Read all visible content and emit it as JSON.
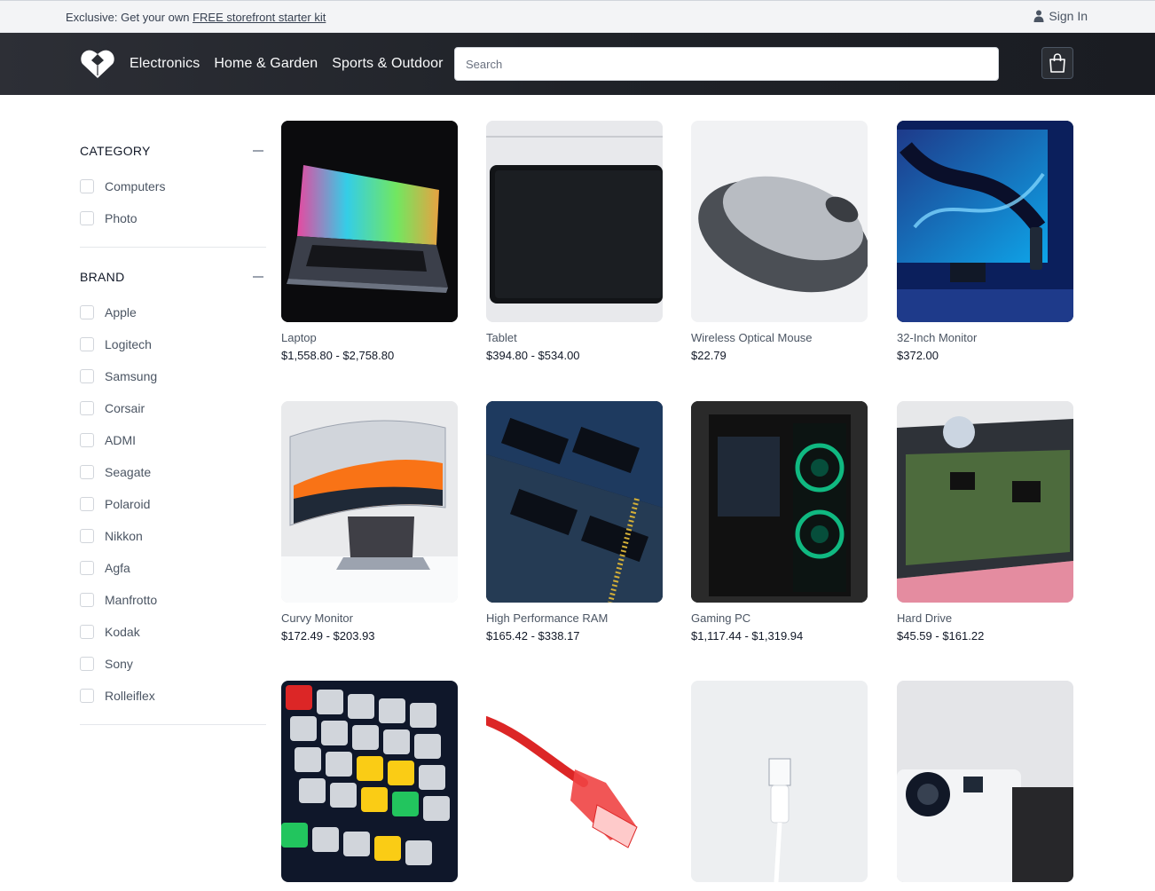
{
  "promo": {
    "prefix": "Exclusive: Get your own ",
    "link": "FREE storefront starter kit"
  },
  "account": {
    "sign_in": "Sign In",
    "icon": "user-icon"
  },
  "nav": {
    "items": [
      "Electronics",
      "Home & Garden",
      "Sports & Outdoor"
    ]
  },
  "search": {
    "placeholder": "Search",
    "value": ""
  },
  "cart": {
    "icon": "shopping-bag-icon"
  },
  "filters": {
    "category": {
      "title": "CATEGORY",
      "options": [
        "Computers",
        "Photo"
      ]
    },
    "brand": {
      "title": "BRAND",
      "options": [
        "Apple",
        "Logitech",
        "Samsung",
        "Corsair",
        "ADMI",
        "Seagate",
        "Polaroid",
        "Nikkon",
        "Agfa",
        "Manfrotto",
        "Kodak",
        "Sony",
        "Rolleiflex"
      ]
    }
  },
  "products": [
    {
      "name": "Laptop",
      "price": "$1,558.80 - $2,758.80"
    },
    {
      "name": "Tablet",
      "price": "$394.80 - $534.00"
    },
    {
      "name": "Wireless Optical Mouse",
      "price": "$22.79"
    },
    {
      "name": "32-Inch Monitor",
      "price": "$372.00"
    },
    {
      "name": "Curvy Monitor",
      "price": "$172.49 - $203.93"
    },
    {
      "name": "High Performance RAM",
      "price": "$165.42 - $338.17"
    },
    {
      "name": "Gaming PC",
      "price": "$1,117.44 - $1,319.94"
    },
    {
      "name": "Hard Drive",
      "price": "$45.59 - $161.22"
    },
    {
      "name": "",
      "price": ""
    },
    {
      "name": "",
      "price": ""
    },
    {
      "name": "",
      "price": ""
    },
    {
      "name": "",
      "price": ""
    }
  ]
}
